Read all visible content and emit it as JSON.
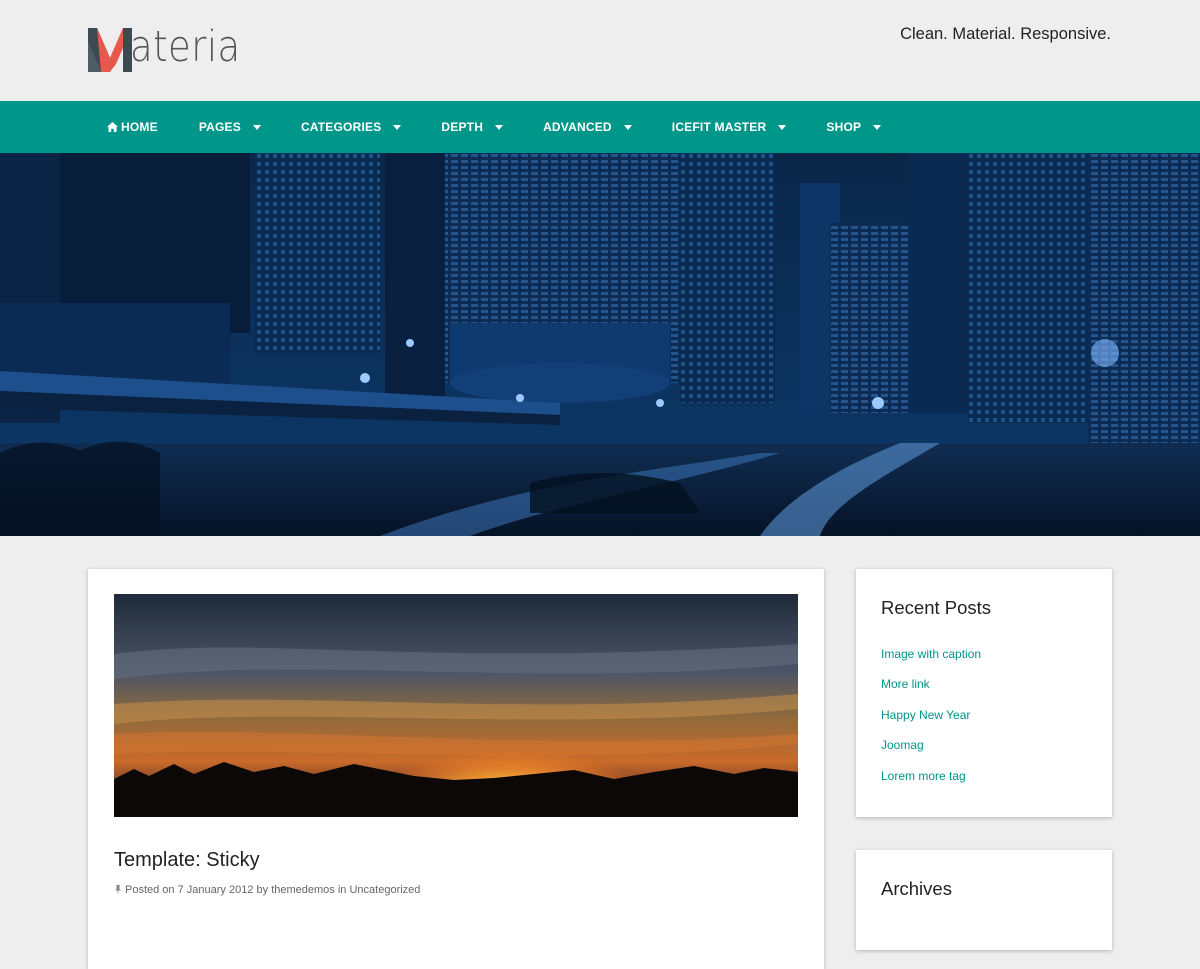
{
  "site": {
    "logo_text": "ateria",
    "logo_letter": "M",
    "tagline": "Clean. Material. Responsive."
  },
  "nav": {
    "items": [
      {
        "label": "Home",
        "icon": "home-icon",
        "dropdown": false
      },
      {
        "label": "Pages",
        "dropdown": true
      },
      {
        "label": "Categories",
        "dropdown": true
      },
      {
        "label": "Depth",
        "dropdown": true
      },
      {
        "label": "Advanced",
        "dropdown": true
      },
      {
        "label": "Icefit Master",
        "dropdown": true
      },
      {
        "label": "Shop",
        "dropdown": true
      }
    ]
  },
  "post": {
    "title": "Template: Sticky",
    "meta_prefix": "Posted on",
    "date": "7 January 2012",
    "by": "by",
    "author": "themedemos",
    "in": "in",
    "category": "Uncategorized"
  },
  "sidebar": {
    "recent_posts": {
      "title": "Recent Posts",
      "items": [
        "Image with caption",
        "More link",
        "Happy New Year",
        "Joomag",
        "Lorem more tag"
      ]
    },
    "archives": {
      "title": "Archives"
    }
  },
  "colors": {
    "accent": "#00978a",
    "logo_red": "#e8584c",
    "logo_dark": "#3d4a52"
  }
}
